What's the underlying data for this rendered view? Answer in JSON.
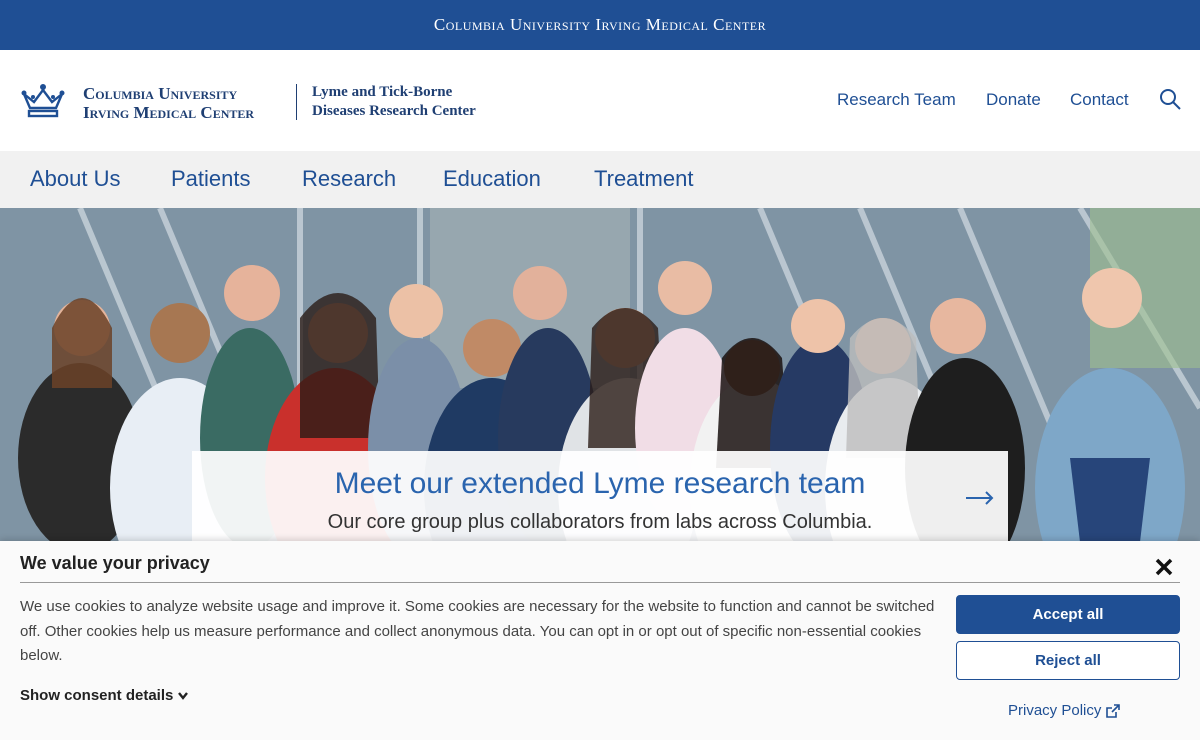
{
  "topbar": {
    "title": "Columbia University Irving Medical Center"
  },
  "header": {
    "brand_line1": "Columbia University",
    "brand_line2": "Irving Medical Center",
    "center_line1": "Lyme and Tick-Borne",
    "center_line2": "Diseases Research Center",
    "utility_links": [
      "Research Team",
      "Donate",
      "Contact"
    ],
    "search_icon": "search-icon"
  },
  "nav": {
    "items": [
      "About Us",
      "Patients",
      "Research",
      "Education",
      "Treatment"
    ]
  },
  "hero": {
    "title": "Meet our extended Lyme research team",
    "subtitle": "Our core group plus collaborators from labs across Columbia.",
    "arrow_icon": "arrow-right-icon"
  },
  "cookie": {
    "title": "We value your privacy",
    "body": "We use cookies to analyze website usage and improve it. Some cookies are necessary for the website to function and cannot be switched off. Other cookies help us measure performance and collect anonymous data. You can opt in or opt out of specific non-essential cookies below.",
    "details_label": "Show consent details",
    "accept_label": "Accept all",
    "reject_label": "Reject all",
    "privacy_label": "Privacy Policy"
  },
  "colors": {
    "brand_blue": "#1f4f94",
    "nav_bg": "#f1f1f1",
    "link_blue": "#2a64ae"
  }
}
